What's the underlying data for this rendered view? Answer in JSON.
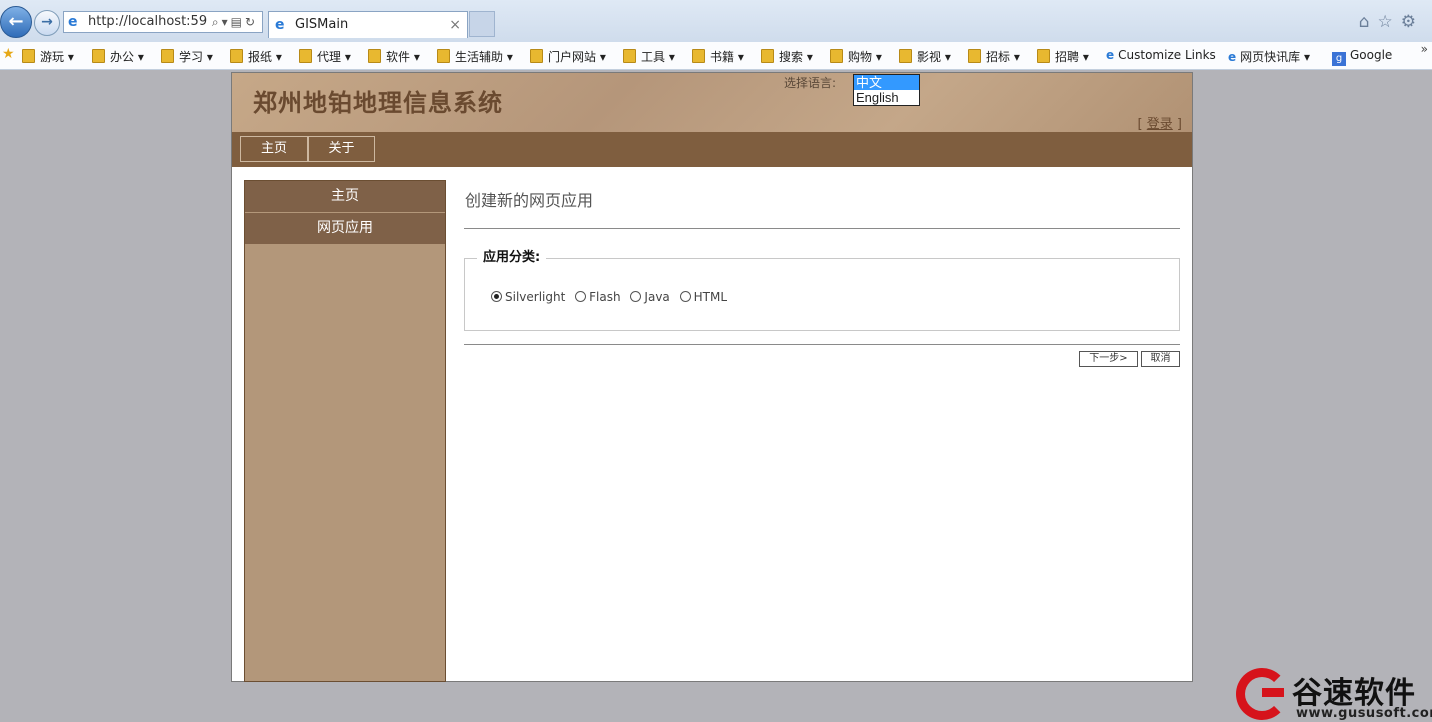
{
  "browser": {
    "address": "http://localhost:59",
    "tab_title": "GISMain",
    "tab_close": "×",
    "favorites": [
      {
        "label": "游玩 ▾",
        "folder": true
      },
      {
        "label": "办公 ▾",
        "folder": true
      },
      {
        "label": "学习 ▾",
        "folder": true
      },
      {
        "label": "报纸 ▾",
        "folder": true
      },
      {
        "label": "代理 ▾",
        "folder": true
      },
      {
        "label": "软件 ▾",
        "folder": true
      },
      {
        "label": "生活辅助 ▾",
        "folder": true
      },
      {
        "label": "门户网站 ▾",
        "folder": true
      },
      {
        "label": "工具 ▾",
        "folder": true
      },
      {
        "label": "书籍 ▾",
        "folder": true
      },
      {
        "label": "搜索 ▾",
        "folder": true
      },
      {
        "label": "购物 ▾",
        "folder": true
      },
      {
        "label": "影视 ▾",
        "folder": true
      },
      {
        "label": "招标 ▾",
        "folder": true
      },
      {
        "label": "招聘 ▾",
        "folder": true
      },
      {
        "label": "Customize Links",
        "folder": false
      },
      {
        "label": "网页快讯库 ▾",
        "folder": false
      },
      {
        "label": "Google",
        "folder": false
      }
    ],
    "more_glyph": "»"
  },
  "header": {
    "site_title": "郑州地铂地理信息系统",
    "lang_label": "选择语言:",
    "lang_options": [
      "中文",
      "English"
    ],
    "login_left": "[ ",
    "login_link": "登录",
    "login_right": " ]"
  },
  "menu": [
    "主页",
    "关于"
  ],
  "sidebar": [
    "主页",
    "网页应用"
  ],
  "content": {
    "title": "创建新的网页应用",
    "legend": "应用分类:",
    "radios": [
      {
        "label": "Silverlight",
        "checked": true
      },
      {
        "label": "Flash",
        "checked": false
      },
      {
        "label": "Java",
        "checked": false
      },
      {
        "label": "HTML",
        "checked": false
      }
    ],
    "next_button": "下一步>",
    "cancel_button": "取消"
  },
  "watermark": {
    "brand": "谷速软件",
    "url": "www.gususoft.com"
  },
  "colors": {
    "header_brown": "#b5967a",
    "menu_brown": "#7f5e3f",
    "sidebar_tan": "#b3977a",
    "selected_lang": "#3399ff",
    "watermark_red": "#d6131b"
  }
}
